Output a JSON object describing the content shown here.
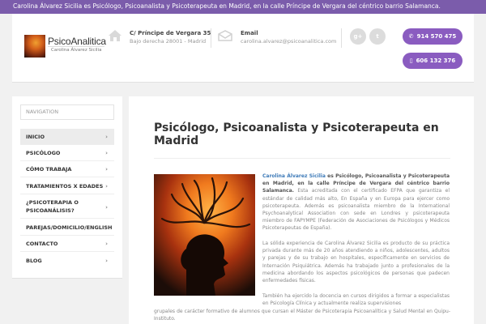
{
  "topbar": {
    "text": "Carolina Álvarez Sicilia es Psicólogo, Psicoanalista y Psicoterapeuta en Madrid, en la calle Príncipe de Vergara del céntrico barrio Salamanca."
  },
  "header": {
    "logo_title": "PsicoAnalitica",
    "logo_subtitle": "Carolina Álvarez Sicilia",
    "address_line1": "C/ Príncipe de Vergara 35",
    "address_line2": "Bajo derecha 28001 - Madrid",
    "email_label": "Email",
    "email_value": "carolina.alvarez@psicoanalitica.com",
    "social_gplus": "g+",
    "social_twitter": "t",
    "phone1": "914 570 475",
    "phone2": "606 132 376",
    "phone_icon": "phone-icon",
    "mobile_icon": "mobile-icon"
  },
  "sidebar": {
    "label": "NAVIGATION",
    "items": [
      {
        "label": "INICIO"
      },
      {
        "label": "PSICÓLOGO"
      },
      {
        "label": "CÓMO TRABAJA"
      },
      {
        "label": "TRATAMIENTOS X EDADES"
      },
      {
        "label": "¿PSICOTERAPIA O PSICOANÁLISIS?"
      },
      {
        "label": "PAREJAS/DOMICILIO/ENGLISH"
      },
      {
        "label": "CONTACTO"
      },
      {
        "label": "BLOG"
      }
    ],
    "arrow": "›"
  },
  "main": {
    "title": "Psicólogo, Psicoanalista y Psicoterapeuta en Madrid",
    "p1_strong": "Carolina Álvarez Sicilia",
    "p1_rest": " es Psicólogo, Psicoanalista y Psicoterapeuta en Madrid, en la calle Príncipe de Vergara del céntrico barrio Salamanca.",
    "p1_body": " Esta acreditada con el certificado EFPA que garantiza el estándar de calidad más alto, En España y en Europa para ejercer como psicoterapeuta. Además es psicoanalista miembro de la International Psychoanalytical Association con sede en Londres y psicoterapeuta miembro de FAPYMPE (Federación de Asociaciones de Psicólogos y Médicos Psicoterapeutas de España).",
    "p2": "La sólida experiencia de Carolina Álvarez Sicilia es producto de su práctica privada durante más de 20 años atendiendo a niños, adolescentes, adultos y parejas y de su trabajo en hospitales, específicamente en servicios de Internación Psiquiátrica. Además ha trabajado junto a profesionales de la medicina abordando los aspectos psicológicos de personas que padecen enfermedades físicas.",
    "p3a": "También ha ejercido la docencia en cursos dirigidos a formar a especialistas en Psicología Clínica y actualmente realiza supervisiones",
    "p3b": "grupales de carácter formativo de alumnos que cursan el Máster de Psicoterapia Psicoanalítica y Salud Mental en Quipu-Instituto."
  },
  "colors": {
    "topbar": "#7b5cab",
    "phone_button": "#8a5cc0",
    "link": "#3d7ab8"
  }
}
